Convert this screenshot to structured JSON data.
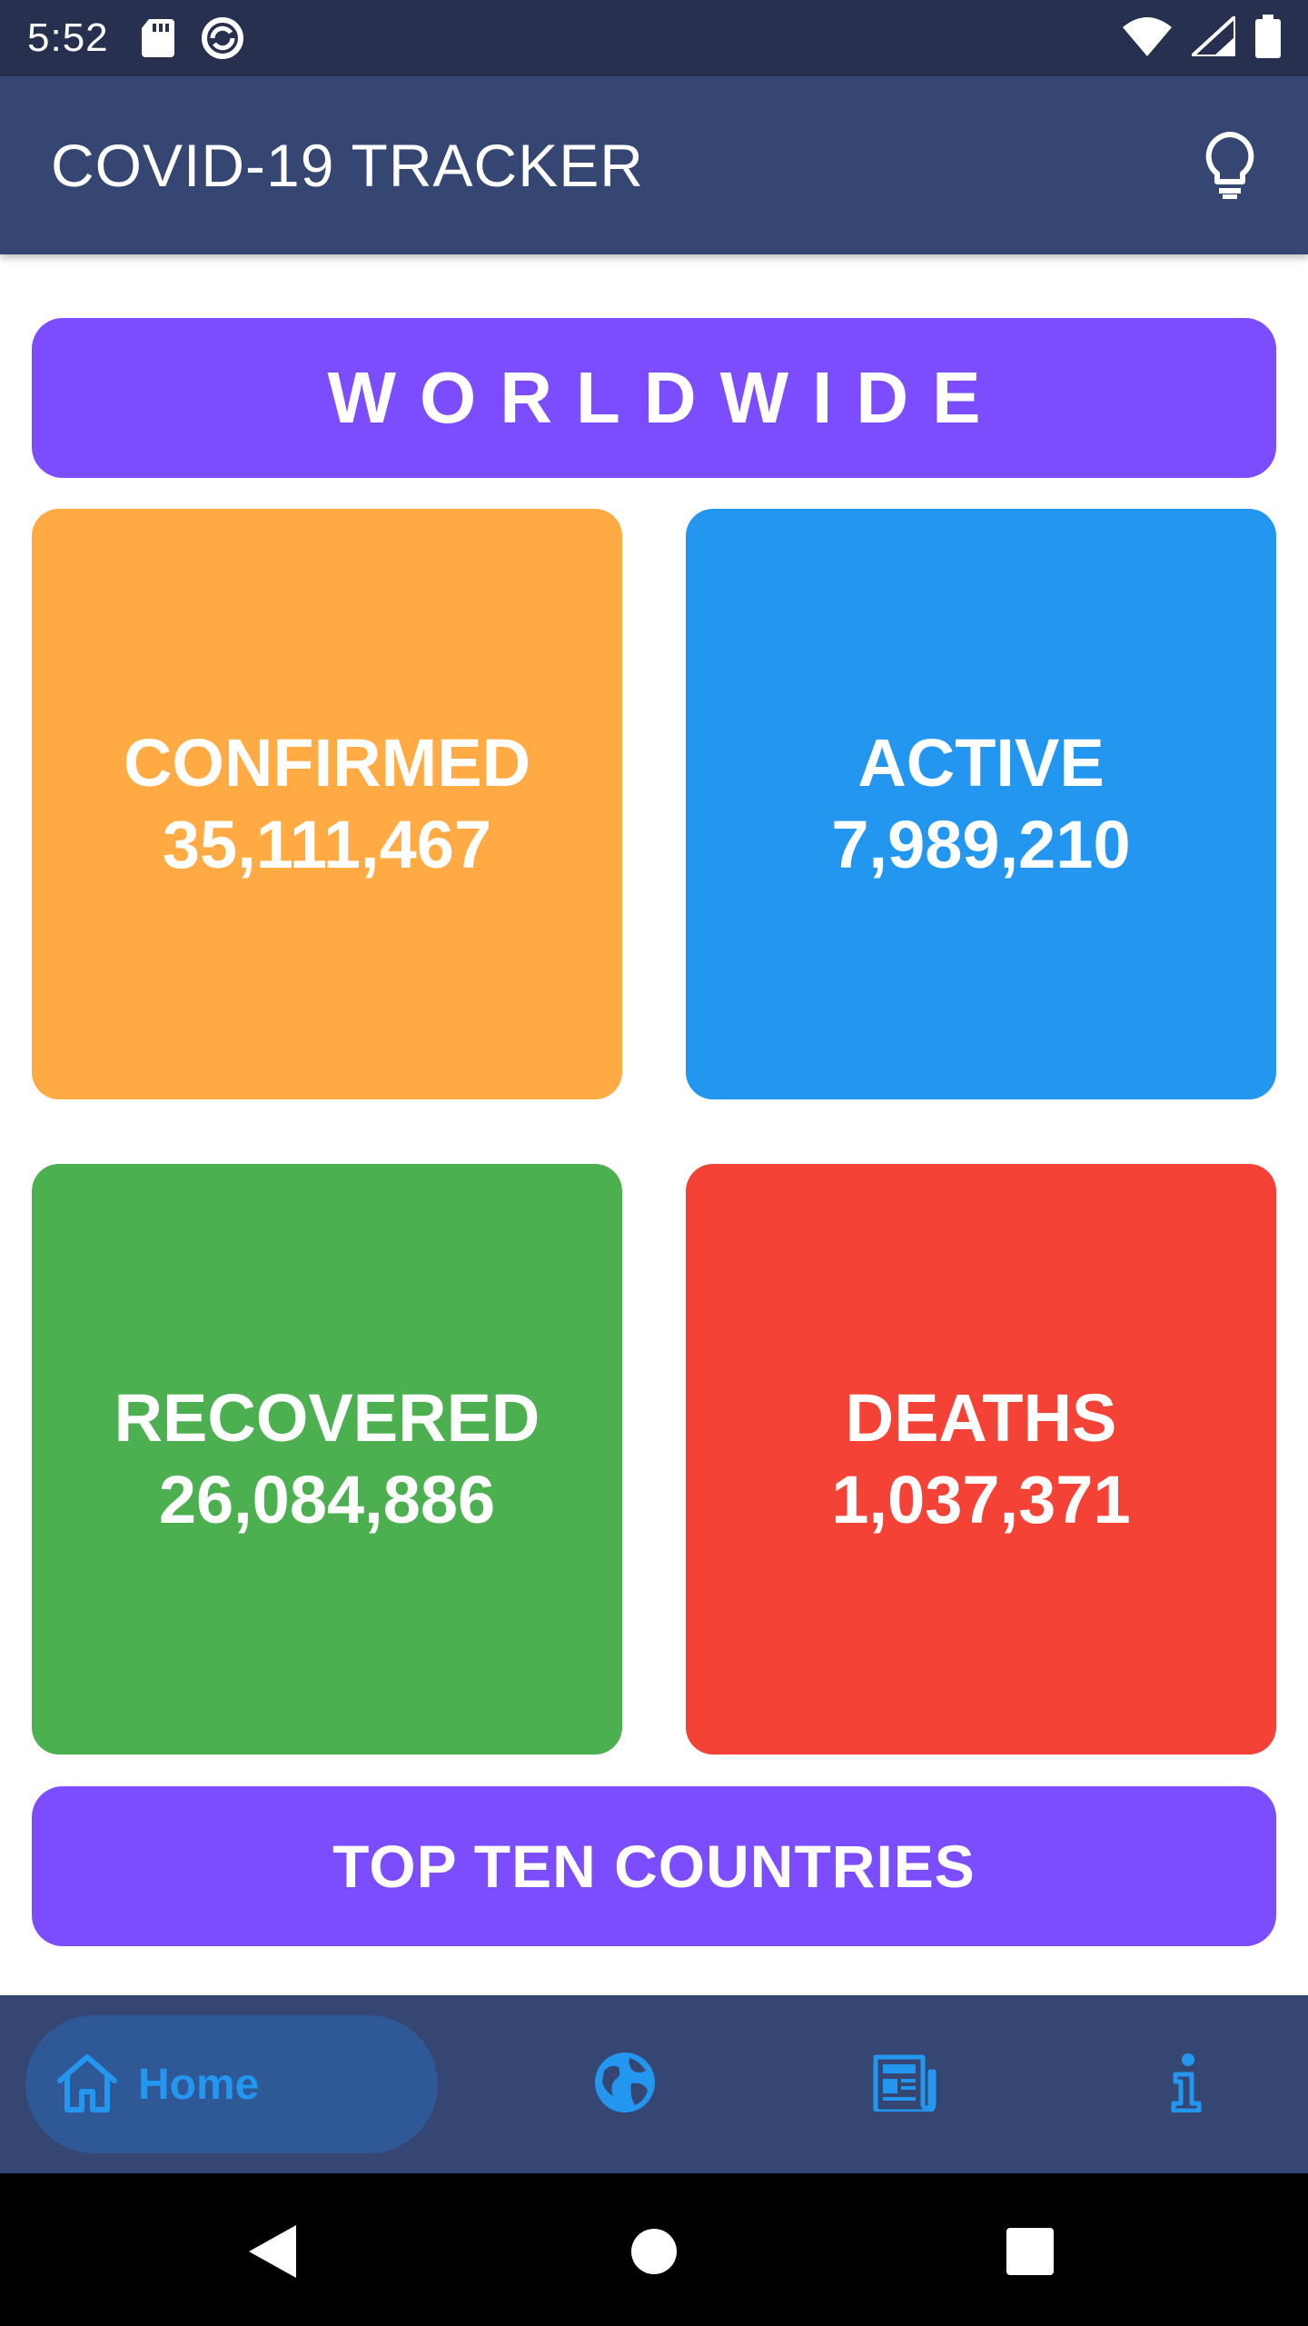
{
  "status_bar": {
    "time": "5:52",
    "icons": [
      "sd-card-icon",
      "sync-icon",
      "wifi-icon",
      "signal-icon",
      "battery-icon"
    ]
  },
  "app_bar": {
    "title": "COVID-19 TRACKER",
    "action_icon": "lightbulb-icon"
  },
  "main": {
    "header": "WORLDWIDE",
    "stats": [
      {
        "label": "CONFIRMED",
        "value": "35,111,467",
        "color": "#ffaa42"
      },
      {
        "label": "ACTIVE",
        "value": "7,989,210",
        "color": "#2396f0"
      },
      {
        "label": "RECOVERED",
        "value": "26,084,886",
        "color": "#4caf50"
      },
      {
        "label": "DEATHS",
        "value": "1,037,371",
        "color": "#f44336"
      }
    ],
    "top_ten_button": "TOP TEN COUNTRIES"
  },
  "bottom_nav": {
    "items": [
      {
        "label": "Home",
        "icon": "home-icon",
        "selected": true
      },
      {
        "label": "",
        "icon": "globe-icon",
        "selected": false
      },
      {
        "label": "",
        "icon": "newspaper-icon",
        "selected": false
      },
      {
        "label": "",
        "icon": "info-icon",
        "selected": false
      }
    ]
  },
  "colors": {
    "status_bar": "#27314f",
    "app_bar": "#364673",
    "accent_purple": "#7c4dff",
    "nav_selected": "#2396f0"
  }
}
